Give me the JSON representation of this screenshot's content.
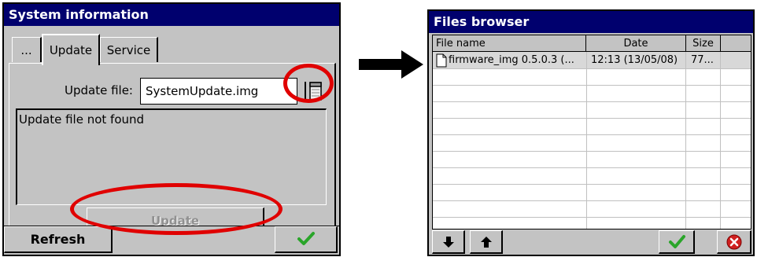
{
  "system_window": {
    "title": "System information",
    "tabs": [
      {
        "label": "...",
        "active": false
      },
      {
        "label": "Update",
        "active": true
      },
      {
        "label": "Service",
        "active": false
      }
    ],
    "update_file_label": "Update file:",
    "update_file_value": "SystemUpdate.img",
    "status_text": "Update file not found",
    "update_button": "Update",
    "refresh_button": "Refresh",
    "ok_icon": "checkmark-icon",
    "browse_icon": "file-browse-icon"
  },
  "files_window": {
    "title": "Files browser",
    "columns": [
      "File name",
      "Date",
      "Size"
    ],
    "rows": [
      {
        "name": "firmware_img 0.5.0.3 (...",
        "date": "12:13 (13/05/08)",
        "size": "77..."
      }
    ],
    "buttons": [
      "arrow-down-icon",
      "arrow-up-icon",
      "checkmark-icon",
      "cancel-icon"
    ]
  },
  "colors": {
    "titlebar": "#00006e",
    "face": "#c3c3c3",
    "highlight_ring": "#e00000",
    "ok_green": "#2aa52a",
    "cancel_red": "#d02020"
  }
}
